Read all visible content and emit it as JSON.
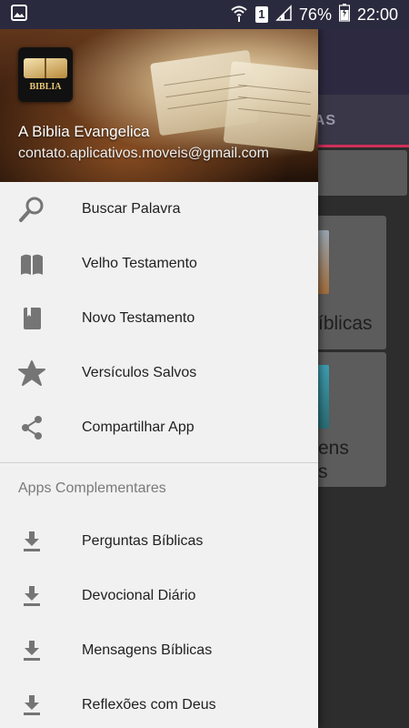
{
  "status_bar": {
    "battery_percent": "76%",
    "time": "22:00",
    "sim_label": "1"
  },
  "background_app": {
    "tab_label": "AS",
    "cards": [
      {
        "text_lines": [
          "íblicas"
        ]
      },
      {
        "text_lines": [
          "ens",
          "s"
        ]
      }
    ]
  },
  "drawer": {
    "header": {
      "app_name": "A Biblia Evangelica",
      "email": "contato.aplicativos.moveis@gmail.com",
      "logo_text": "BIBLIA"
    },
    "menu_items": [
      {
        "label": "Buscar Palavra",
        "icon": "search-icon"
      },
      {
        "label": "Velho Testamento",
        "icon": "open-book-icon"
      },
      {
        "label": "Novo Testamento",
        "icon": "closed-book-icon"
      },
      {
        "label": "Versículos Salvos",
        "icon": "star-icon"
      },
      {
        "label": "Compartilhar App",
        "icon": "share-icon"
      }
    ],
    "section_title": "Apps Complementares",
    "app_items": [
      {
        "label": "Perguntas Bíblicas",
        "icon": "download-icon"
      },
      {
        "label": "Devocional Diário",
        "icon": "download-icon"
      },
      {
        "label": "Mensagens Bíblicas",
        "icon": "download-icon"
      },
      {
        "label": "Reflexões com Deus",
        "icon": "download-icon"
      }
    ]
  }
}
